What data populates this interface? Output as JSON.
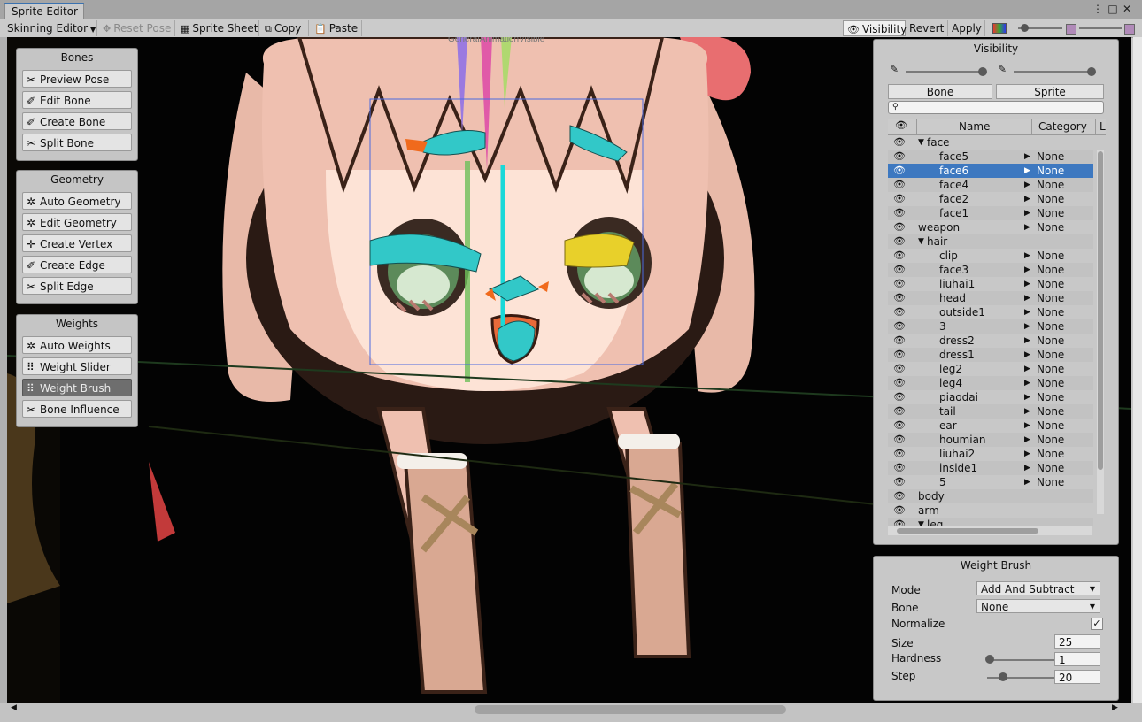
{
  "window": {
    "tab_title": "Sprite Editor",
    "menu_icon": "kebab-menu-icon",
    "maximize_icon": "maximize-icon",
    "close_icon": "close-icon"
  },
  "toolbar": {
    "mode_label": "Skinning Editor",
    "reset_pose_label": "Reset Pose",
    "sprite_sheet_label": "Sprite Sheet",
    "copy_label": "Copy",
    "paste_label": "Paste",
    "visibility_label": "Visibility",
    "revert_label": "Revert",
    "apply_label": "Apply"
  },
  "canvas": {
    "overlay_text": "GeneralAnimationVisible"
  },
  "bones_panel": {
    "title": "Bones",
    "buttons": [
      "Preview Pose",
      "Edit Bone",
      "Create Bone",
      "Split Bone"
    ]
  },
  "geometry_panel": {
    "title": "Geometry",
    "buttons": [
      "Auto Geometry",
      "Edit Geometry",
      "Create Vertex",
      "Create Edge",
      "Split Edge"
    ]
  },
  "weights_panel": {
    "title": "Weights",
    "buttons": [
      "Auto Weights",
      "Weight Slider",
      "Weight Brush",
      "Bone Influence"
    ],
    "active": "Weight Brush"
  },
  "visibility_panel": {
    "title": "Visibility",
    "tabs": [
      "Bone",
      "Sprite"
    ],
    "columns": [
      "Name",
      "Category",
      "L"
    ],
    "rows": [
      {
        "name": "face",
        "level": 0,
        "folder": true,
        "category": ""
      },
      {
        "name": "face5",
        "level": 1,
        "category": "None"
      },
      {
        "name": "face6",
        "level": 1,
        "category": "None",
        "selected": true
      },
      {
        "name": "face4",
        "level": 1,
        "category": "None"
      },
      {
        "name": "face2",
        "level": 1,
        "category": "None"
      },
      {
        "name": "face1",
        "level": 1,
        "category": "None"
      },
      {
        "name": "weapon",
        "level": 0,
        "category": "None"
      },
      {
        "name": "hair",
        "level": 0,
        "folder": true,
        "category": ""
      },
      {
        "name": "clip",
        "level": 1,
        "category": "None"
      },
      {
        "name": "face3",
        "level": 1,
        "category": "None"
      },
      {
        "name": "liuhai1",
        "level": 1,
        "category": "None"
      },
      {
        "name": "head",
        "level": 1,
        "category": "None"
      },
      {
        "name": "outside1",
        "level": 1,
        "category": "None"
      },
      {
        "name": "3",
        "level": 1,
        "category": "None"
      },
      {
        "name": "dress2",
        "level": 1,
        "category": "None"
      },
      {
        "name": "dress1",
        "level": 1,
        "category": "None"
      },
      {
        "name": "leg2",
        "level": 1,
        "category": "None"
      },
      {
        "name": "leg4",
        "level": 1,
        "category": "None"
      },
      {
        "name": "piaodai",
        "level": 1,
        "category": "None"
      },
      {
        "name": "tail",
        "level": 1,
        "category": "None"
      },
      {
        "name": "ear",
        "level": 1,
        "category": "None"
      },
      {
        "name": "houmian",
        "level": 1,
        "category": "None"
      },
      {
        "name": "liuhai2",
        "level": 1,
        "category": "None"
      },
      {
        "name": "inside1",
        "level": 1,
        "category": "None"
      },
      {
        "name": "5",
        "level": 1,
        "category": "None"
      },
      {
        "name": "body",
        "level": 0,
        "category": ""
      },
      {
        "name": "arm",
        "level": 0,
        "category": ""
      },
      {
        "name": "leg",
        "level": 0,
        "folder": true,
        "category": ""
      }
    ]
  },
  "weight_brush": {
    "title": "Weight Brush",
    "mode_label": "Mode",
    "mode_value": "Add And Subtract",
    "bone_label": "Bone",
    "bone_value": "None",
    "normalize_label": "Normalize",
    "normalize_checked": true,
    "size_label": "Size",
    "size_value": "25",
    "hardness_label": "Hardness",
    "hardness_value": "1",
    "hardness_level": 0,
    "step_label": "Step",
    "step_value": "20",
    "step_level": 0.2
  }
}
